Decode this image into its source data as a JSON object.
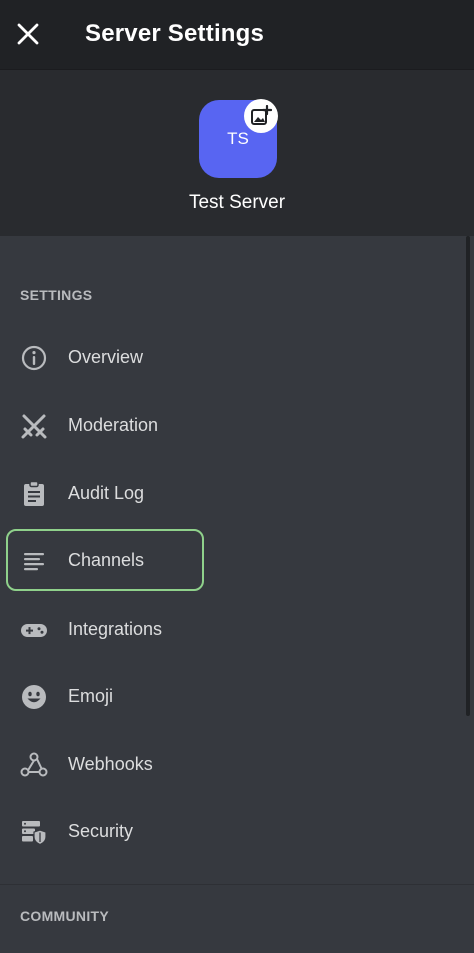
{
  "header": {
    "title": "Server Settings",
    "close_icon": "close-icon"
  },
  "server": {
    "initials": "TS",
    "name": "Test Server",
    "avatar_color": "#5865f2"
  },
  "sections": {
    "settings_label": "SETTINGS",
    "community_label": "COMMUNITY"
  },
  "menu": {
    "items": [
      {
        "label": "Overview",
        "icon": "info-icon"
      },
      {
        "label": "Moderation",
        "icon": "swords-icon"
      },
      {
        "label": "Audit Log",
        "icon": "clipboard-icon"
      },
      {
        "label": "Channels",
        "icon": "channels-icon",
        "active": true
      },
      {
        "label": "Integrations",
        "icon": "gamepad-icon"
      },
      {
        "label": "Emoji",
        "icon": "emoji-icon"
      },
      {
        "label": "Webhooks",
        "icon": "webhooks-icon"
      },
      {
        "label": "Security",
        "icon": "security-icon"
      }
    ]
  },
  "colors": {
    "background": "#36393f",
    "header": "#202225",
    "panel": "#292b2f",
    "highlight": "#8fd18b",
    "accent": "#5865f2"
  }
}
